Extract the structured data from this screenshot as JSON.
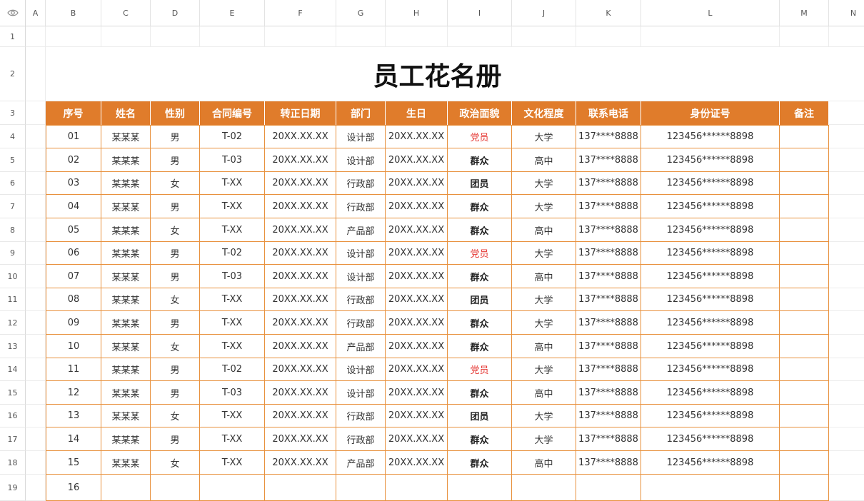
{
  "columns": [
    "A",
    "B",
    "C",
    "D",
    "E",
    "F",
    "G",
    "H",
    "I",
    "J",
    "K",
    "L",
    "M",
    "N"
  ],
  "rows": [
    "1",
    "2",
    "3",
    "4",
    "5",
    "6",
    "7",
    "8",
    "9",
    "10",
    "11",
    "12",
    "13",
    "14",
    "15",
    "16",
    "17",
    "18",
    "19"
  ],
  "visibility_icon": "eye-icon",
  "title": "员工花名册",
  "headers": [
    "序号",
    "姓名",
    "性别",
    "合同编号",
    "转正日期",
    "部门",
    "生日",
    "政治面貌",
    "文化程度",
    "联系电话",
    "身份证号",
    "备注"
  ],
  "records": [
    [
      "01",
      "某某某",
      "男",
      "T-02",
      "20XX.XX.XX",
      "设计部",
      "20XX.XX.XX",
      "党员",
      "大学",
      "137****8888",
      "123456******8898",
      ""
    ],
    [
      "02",
      "某某某",
      "男",
      "T-03",
      "20XX.XX.XX",
      "设计部",
      "20XX.XX.XX",
      "群众",
      "高中",
      "137****8888",
      "123456******8898",
      ""
    ],
    [
      "03",
      "某某某",
      "女",
      "T-XX",
      "20XX.XX.XX",
      "行政部",
      "20XX.XX.XX",
      "团员",
      "大学",
      "137****8888",
      "123456******8898",
      ""
    ],
    [
      "04",
      "某某某",
      "男",
      "T-XX",
      "20XX.XX.XX",
      "行政部",
      "20XX.XX.XX",
      "群众",
      "大学",
      "137****8888",
      "123456******8898",
      ""
    ],
    [
      "05",
      "某某某",
      "女",
      "T-XX",
      "20XX.XX.XX",
      "产品部",
      "20XX.XX.XX",
      "群众",
      "高中",
      "137****8888",
      "123456******8898",
      ""
    ],
    [
      "06",
      "某某某",
      "男",
      "T-02",
      "20XX.XX.XX",
      "设计部",
      "20XX.XX.XX",
      "党员",
      "大学",
      "137****8888",
      "123456******8898",
      ""
    ],
    [
      "07",
      "某某某",
      "男",
      "T-03",
      "20XX.XX.XX",
      "设计部",
      "20XX.XX.XX",
      "群众",
      "高中",
      "137****8888",
      "123456******8898",
      ""
    ],
    [
      "08",
      "某某某",
      "女",
      "T-XX",
      "20XX.XX.XX",
      "行政部",
      "20XX.XX.XX",
      "团员",
      "大学",
      "137****8888",
      "123456******8898",
      ""
    ],
    [
      "09",
      "某某某",
      "男",
      "T-XX",
      "20XX.XX.XX",
      "行政部",
      "20XX.XX.XX",
      "群众",
      "大学",
      "137****8888",
      "123456******8898",
      ""
    ],
    [
      "10",
      "某某某",
      "女",
      "T-XX",
      "20XX.XX.XX",
      "产品部",
      "20XX.XX.XX",
      "群众",
      "高中",
      "137****8888",
      "123456******8898",
      ""
    ],
    [
      "11",
      "某某某",
      "男",
      "T-02",
      "20XX.XX.XX",
      "设计部",
      "20XX.XX.XX",
      "党员",
      "大学",
      "137****8888",
      "123456******8898",
      ""
    ],
    [
      "12",
      "某某某",
      "男",
      "T-03",
      "20XX.XX.XX",
      "设计部",
      "20XX.XX.XX",
      "群众",
      "高中",
      "137****8888",
      "123456******8898",
      ""
    ],
    [
      "13",
      "某某某",
      "女",
      "T-XX",
      "20XX.XX.XX",
      "行政部",
      "20XX.XX.XX",
      "团员",
      "大学",
      "137****8888",
      "123456******8898",
      ""
    ],
    [
      "14",
      "某某某",
      "男",
      "T-XX",
      "20XX.XX.XX",
      "行政部",
      "20XX.XX.XX",
      "群众",
      "大学",
      "137****8888",
      "123456******8898",
      ""
    ],
    [
      "15",
      "某某某",
      "女",
      "T-XX",
      "20XX.XX.XX",
      "产品部",
      "20XX.XX.XX",
      "群众",
      "高中",
      "137****8888",
      "123456******8898",
      ""
    ],
    [
      "16",
      "",
      "",
      "",
      "",
      "",
      "",
      "",
      "",
      "",
      "",
      ""
    ]
  ],
  "colors": {
    "header_bg": "#e07c2b",
    "border": "#e8913d",
    "party_member": "#e53935"
  }
}
